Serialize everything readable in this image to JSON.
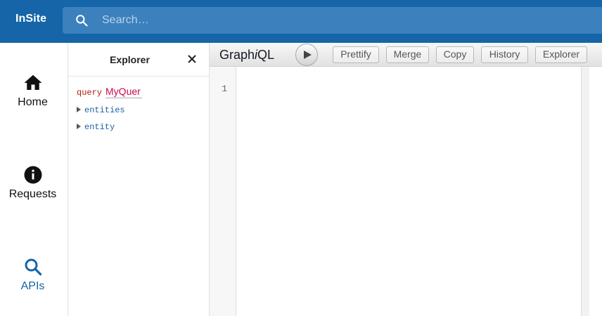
{
  "app": {
    "brand": "InSite"
  },
  "search": {
    "placeholder": "Search…",
    "value": ""
  },
  "nav": {
    "items": [
      {
        "label": "Home",
        "icon": "home-icon"
      },
      {
        "label": "Requests",
        "icon": "info-icon"
      },
      {
        "label": "APIs",
        "icon": "search-icon",
        "active": true
      }
    ]
  },
  "explorer": {
    "title": "Explorer",
    "keyword": "query",
    "operation_name": "MyQuer",
    "fields": [
      "entities",
      "entity"
    ]
  },
  "graphiql": {
    "title_prefix": "Graph",
    "title_italic": "i",
    "title_suffix": "QL",
    "buttons": {
      "prettify": "Prettify",
      "merge": "Merge",
      "copy": "Copy",
      "history": "History",
      "explorer": "Explorer"
    }
  },
  "editor": {
    "line_numbers": [
      "1"
    ]
  },
  "colors": {
    "topbar": "#1565a8",
    "search_bg": "#3c80be",
    "active_nav": "#1565a8"
  }
}
